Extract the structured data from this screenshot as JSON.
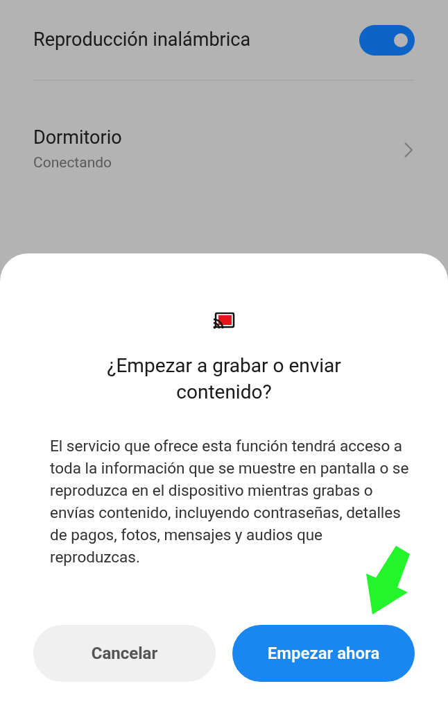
{
  "settings": [
    {
      "kind": "toggle",
      "label": "Reproducción inalámbrica",
      "on": true
    },
    {
      "kind": "device",
      "name": "Dormitorio",
      "status": "Conectando"
    }
  ],
  "dialog": {
    "title": "¿Empezar a grabar o enviar contenido?",
    "body": "El servicio que ofrece esta función tendrá acceso a toda la información que se muestre en pantalla o se reproduzca en el dispositivo mientras grabas o envías contenido, incluyendo contraseñas, detalles de pagos, fotos, mensajes y audios que reproduzcas.",
    "buttons": [
      {
        "kind": "secondary",
        "label": "Cancelar"
      },
      {
        "kind": "primary",
        "label": "Empezar ahora"
      }
    ]
  }
}
